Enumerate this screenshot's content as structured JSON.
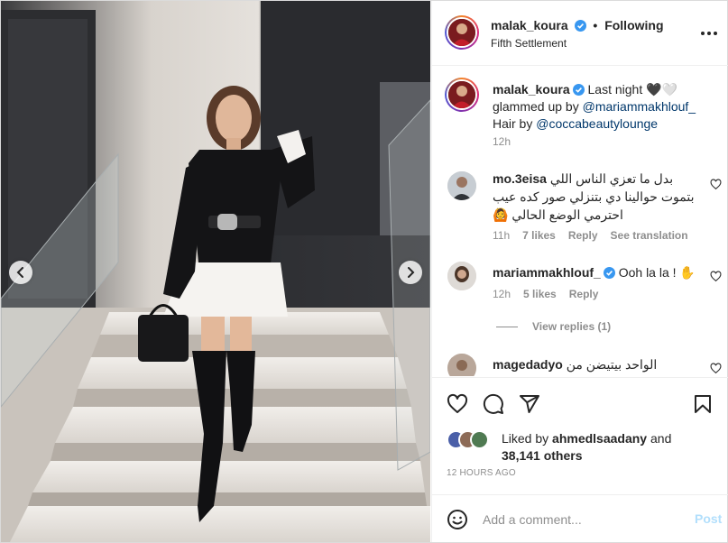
{
  "post": {
    "username": "malak_koura",
    "following_label": "Following",
    "location": "Fifth Settlement",
    "caption_part1": "Last night 🖤🤍 glammed up by ",
    "caption_mention1": "@mariammakhlouf_",
    "caption_part2": " Hair by ",
    "caption_mention2": "@coccabeautylounge",
    "caption_time": "12h"
  },
  "comments": [
    {
      "username": "mo.3eisa",
      "text": "بدل ما تعزي الناس اللي بتموت حوالينا دي بتنزلي صور كده عيب احترمي الوضع الحالي 🙆",
      "time": "11h",
      "likes": "7 likes",
      "reply": "Reply",
      "translate": "See translation"
    },
    {
      "username": "mariammakhlouf_",
      "text": "Ooh la la ! ✋",
      "time": "12h",
      "likes": "5 likes",
      "reply": "Reply",
      "view_replies": "View replies (1)"
    },
    {
      "username": "magedadyo",
      "text": "الواحد بيتيضن من"
    }
  ],
  "likes": {
    "prefix": "Liked by",
    "user": "ahmedlsaadany",
    "conjunction": "and",
    "others": "38,141 others"
  },
  "timestamp": "12 HOURS AGO",
  "add_comment": {
    "placeholder": "Add a comment...",
    "post_label": "Post"
  },
  "colors": {
    "link": "#00376b",
    "verified": "#3897f0",
    "post_button": "#b2dffc",
    "muted": "#8e8e8e"
  },
  "icons": [
    "chevron-left-icon",
    "chevron-right-icon",
    "verified-icon",
    "more-icon",
    "heart-icon",
    "comment-icon",
    "share-icon",
    "bookmark-icon",
    "emoji-icon"
  ]
}
